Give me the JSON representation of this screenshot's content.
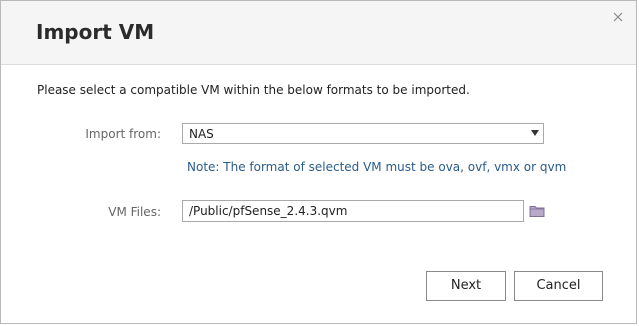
{
  "dialog": {
    "title": "Import VM",
    "close_icon": "close-icon"
  },
  "intro_text": "Please select a compatible VM within the below formats to be imported.",
  "import_from": {
    "label": "Import from:",
    "selected": "NAS",
    "dropdown_icon": "caret-down-icon"
  },
  "note": "Note: The format of selected VM must be ova, ovf, vmx or qvm",
  "vm_files": {
    "label": "VM Files:",
    "value": "/Public/pfSense_2.4.3.qvm",
    "browse_icon": "folder-icon"
  },
  "buttons": {
    "next": "Next",
    "cancel": "Cancel"
  }
}
